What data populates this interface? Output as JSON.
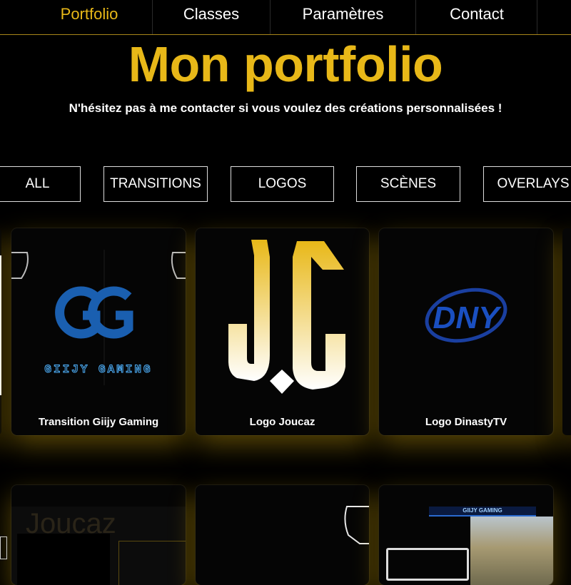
{
  "nav": {
    "items": [
      {
        "label": "Portfolio",
        "active": true
      },
      {
        "label": "Classes"
      },
      {
        "label": "Paramètres"
      },
      {
        "label": "Contact"
      }
    ]
  },
  "hero": {
    "title": "Mon portfolio",
    "subtitle": "N'hésitez pas à me contacter si vous voulez des créations personnalisées !"
  },
  "filters": [
    "ALL",
    "TRANSITIONS",
    "LOGOS",
    "SCÈNES",
    "OVERLAYS"
  ],
  "cards": [
    {
      "caption": "Transition Giijy Gaming",
      "logo_text": "GIIJY GAMING"
    },
    {
      "caption": "Logo Joucaz"
    },
    {
      "caption": "Logo DinastyTV",
      "logo_text": "DNY"
    }
  ],
  "second_row": {
    "card1_text": "Joucaz",
    "card3_banner": "GIIJY GAMING"
  },
  "colors": {
    "accent": "#e8b818",
    "background": "#000000",
    "logo_blue": "#1a5fb0",
    "neon_blue": "#4fb3ff"
  }
}
